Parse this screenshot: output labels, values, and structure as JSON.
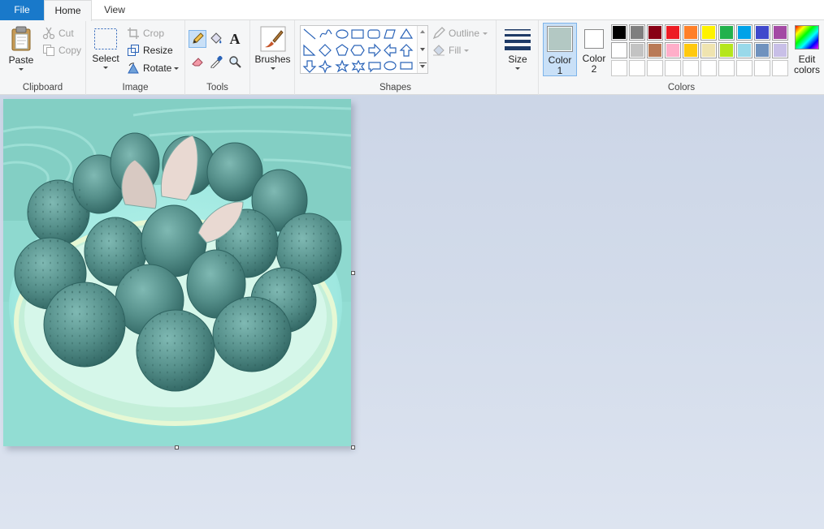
{
  "tabs": {
    "file": "File",
    "home": "Home",
    "view": "View"
  },
  "clipboard": {
    "paste": "Paste",
    "cut": "Cut",
    "copy": "Copy",
    "label": "Clipboard"
  },
  "image": {
    "select": "Select",
    "crop": "Crop",
    "resize": "Resize",
    "rotate": "Rotate",
    "label": "Image"
  },
  "tools": {
    "label": "Tools"
  },
  "brushes": {
    "label": "Brushes"
  },
  "shapes": {
    "outline": "Outline",
    "fill": "Fill",
    "label": "Shapes"
  },
  "size": {
    "label": "Size"
  },
  "color1": {
    "line1": "Color",
    "line2": "1",
    "value": "#b3c8c3"
  },
  "color2": {
    "line1": "Color",
    "line2": "2",
    "value": "#ffffff"
  },
  "colors": {
    "label": "Colors",
    "edit_line1": "Edit",
    "edit_line2": "colors",
    "row1": [
      "#000000",
      "#7f7f7f",
      "#880015",
      "#ed1c24",
      "#ff7f27",
      "#fff200",
      "#22b14c",
      "#00a2e8",
      "#3f48cc",
      "#a349a4"
    ],
    "row2": [
      "#ffffff",
      "#c3c3c3",
      "#b97a57",
      "#ffaec9",
      "#ffc90e",
      "#efe4b0",
      "#b5e61d",
      "#99d9ea",
      "#7092be",
      "#c8bfe7"
    ],
    "row3": [
      "#ffffff",
      "#ffffff",
      "#ffffff",
      "#ffffff",
      "#ffffff",
      "#ffffff",
      "#ffffff",
      "#ffffff",
      "#ffffff",
      "#ffffff"
    ]
  },
  "accent": "#1979ca"
}
